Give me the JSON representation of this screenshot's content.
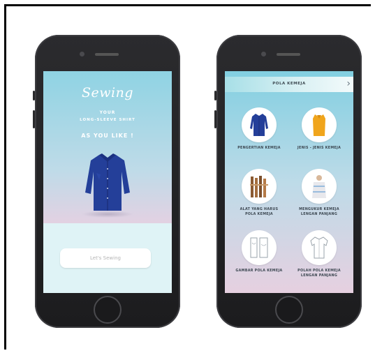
{
  "left_screen": {
    "script_title": "Sewing",
    "subtitle_line1": "YOUR",
    "subtitle_line2": "LONG-SLEEVE SHIRT",
    "tagline": "AS YOU LIKE !",
    "cta_label": "Let's Sewing",
    "shirt_color": "#243f99"
  },
  "right_screen": {
    "header_title": "POLA KEMEJA",
    "menu_items": [
      {
        "label_l1": "PENGERTIAN KEMEJA",
        "label_l2": "",
        "icon": "shirt-icon"
      },
      {
        "label_l1": "JENIS - JENIS KEMEJA",
        "label_l2": "",
        "icon": "yellow-top-icon"
      },
      {
        "label_l1": "ALAT YANG HARUS",
        "label_l2": "POLA KEMEJA",
        "icon": "sewing-tools-icon"
      },
      {
        "label_l1": "MENGUKUR KEMEJA",
        "label_l2": "LENGAN PANJANG",
        "icon": "measuring-icon"
      },
      {
        "label_l1": "GAMBAR POLA KEMEJA",
        "label_l2": "",
        "icon": "pattern-drawing-icon"
      },
      {
        "label_l1": "POLAH POLA KEMEJA",
        "label_l2": "LENGAN PANJANG",
        "icon": "shirt-pattern-icon"
      }
    ]
  },
  "colors": {
    "teal_top": "#8fd3e3",
    "pink_mid": "#f1cde0",
    "mint_bottom": "#dff3f6",
    "shirt_blue": "#243f99",
    "yellow_top": "#f0a51c"
  }
}
